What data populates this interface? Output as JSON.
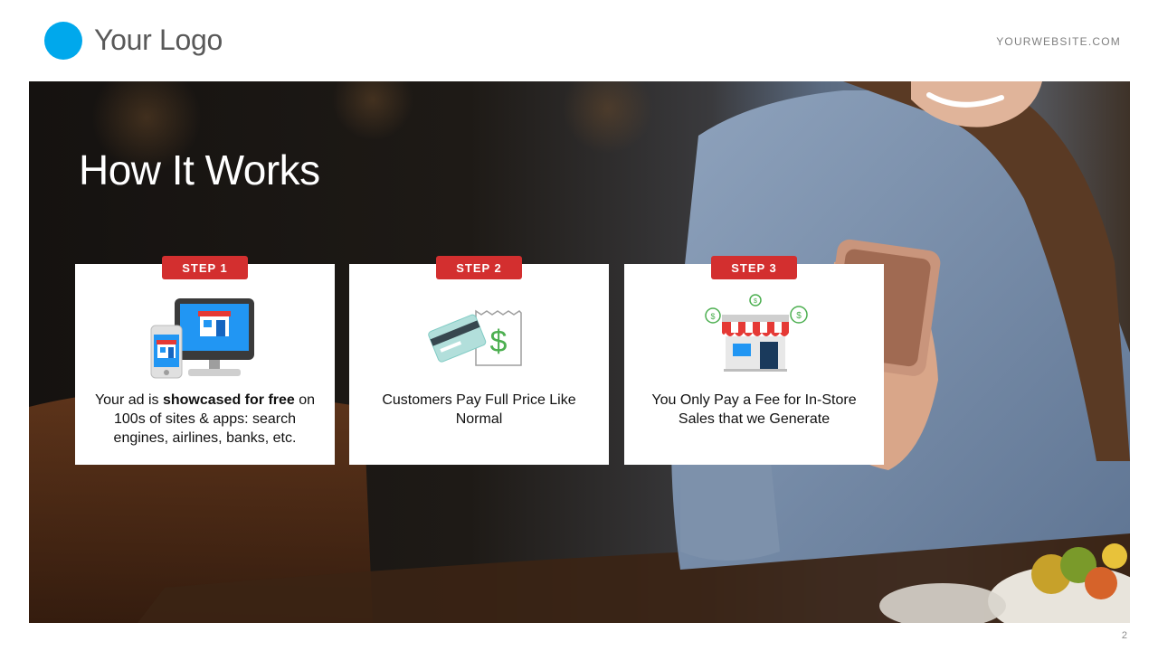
{
  "header": {
    "logo_text": "Your Logo",
    "logo_color": "#00a8ec",
    "website": "YOURWEBSITE.COM"
  },
  "slide": {
    "title": "How It Works",
    "page_number": "2"
  },
  "steps": [
    {
      "badge": "STEP 1",
      "icon": "devices-store-icon",
      "text_before": "Your ad is ",
      "text_bold": "showcased  for free",
      "text_after": " on 100s of sites & apps: search engines, airlines, banks, etc."
    },
    {
      "badge": "STEP 2",
      "icon": "card-receipt-icon",
      "text": "Customers  Pay Full Price Like Normal"
    },
    {
      "badge": "STEP 3",
      "icon": "storefront-money-icon",
      "text": "You Only  Pay a Fee for In-Store Sales that we Generate"
    }
  ],
  "colors": {
    "badge_red": "#d32f2f",
    "money_green": "#4caf50"
  }
}
